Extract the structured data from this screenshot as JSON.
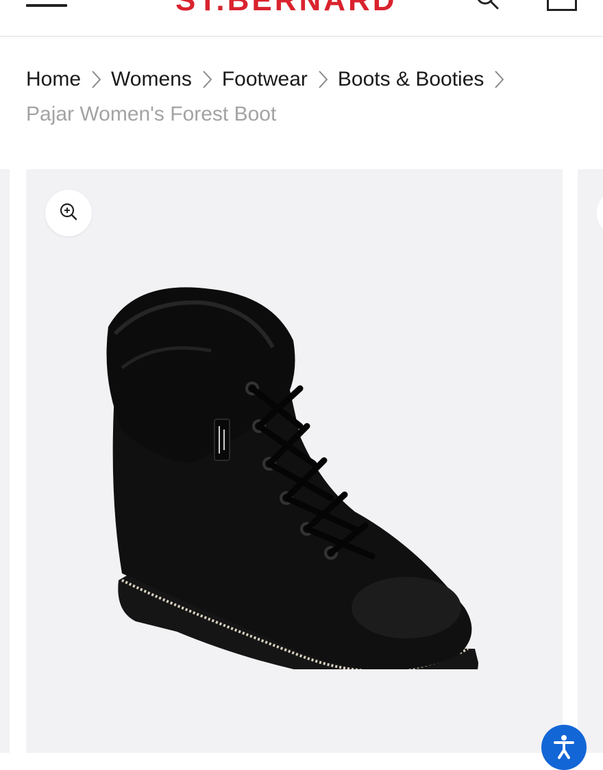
{
  "header": {
    "logo_text": "ST.BERNARD",
    "brand_color": "#d9232e",
    "icons": [
      "menu-icon",
      "search-icon",
      "cart-icon"
    ]
  },
  "breadcrumb": {
    "items": [
      "Home",
      "Womens",
      "Footwear",
      "Boots & Booties"
    ],
    "current": "Pajar Women's Forest Boot",
    "separator_icon": "chevron-right-icon"
  },
  "gallery": {
    "zoom_icon": "zoom-in-icon",
    "product_image_alt": "Pajar Women's Forest Boot",
    "background_color": "#f2f1f4"
  },
  "accessibility": {
    "icon": "accessibility-icon",
    "color": "#1366d6"
  }
}
